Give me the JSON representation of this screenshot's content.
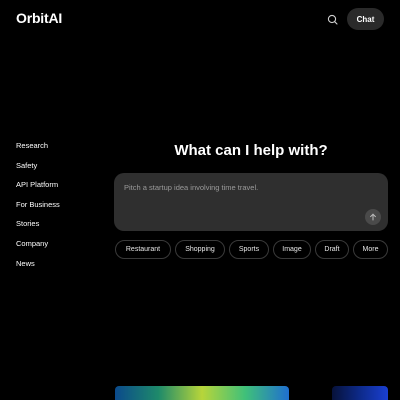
{
  "header": {
    "logo": "OrbitAI",
    "search_icon": "search-icon",
    "chat_label": "Chat"
  },
  "sidebar": {
    "items": [
      {
        "label": "Research"
      },
      {
        "label": "Safety"
      },
      {
        "label": "API Platform"
      },
      {
        "label": "For Business"
      },
      {
        "label": "Stories"
      },
      {
        "label": "Company"
      },
      {
        "label": "News"
      }
    ]
  },
  "main": {
    "heading": "What can I help with?",
    "prompt_placeholder": "Pitch a startup idea involving time travel.",
    "send_icon": "arrow-up-icon",
    "chips": [
      {
        "label": "Restaurant"
      },
      {
        "label": "Shopping"
      },
      {
        "label": "Sports"
      },
      {
        "label": "Image"
      },
      {
        "label": "Draft"
      },
      {
        "label": "More"
      }
    ]
  },
  "colors": {
    "background": "#000000",
    "prompt_box": "#2f2f2f",
    "chat_button": "#2a2a2a"
  }
}
